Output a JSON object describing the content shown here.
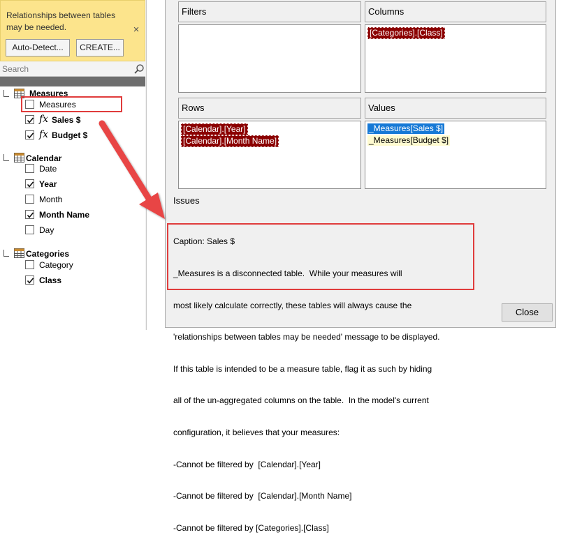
{
  "warning": {
    "message": "Relationships between tables may be needed.",
    "close_glyph": "×",
    "auto_detect_label": "Auto-Detect...",
    "create_label": "CREATE..."
  },
  "search": {
    "placeholder": "Search",
    "icon": "search-icon"
  },
  "tree": {
    "groups": [
      {
        "name": "Measures",
        "icon": "table-icon",
        "fields": [
          {
            "label": "Measures",
            "checked": false,
            "icon": "",
            "bold": false
          },
          {
            "label": "Sales $",
            "checked": true,
            "icon": "fx-icon",
            "bold": true
          },
          {
            "label": "Budget $",
            "checked": true,
            "icon": "fx-icon",
            "bold": true
          }
        ]
      },
      {
        "name": "Calendar",
        "icon": "table-icon",
        "fields": [
          {
            "label": "Date",
            "checked": false,
            "bold": false
          },
          {
            "label": "Year",
            "checked": true,
            "bold": true
          },
          {
            "label": "Month",
            "checked": false,
            "bold": false
          },
          {
            "label": "Month Name",
            "checked": true,
            "bold": true
          },
          {
            "label": "Day",
            "checked": false,
            "bold": false
          }
        ]
      },
      {
        "name": "Categories",
        "icon": "table-icon",
        "fields": [
          {
            "label": "Category",
            "checked": false,
            "bold": false
          },
          {
            "label": "Class",
            "checked": true,
            "bold": true
          }
        ]
      }
    ]
  },
  "areas": {
    "filters": {
      "label": "Filters",
      "items": []
    },
    "columns": {
      "label": "Columns",
      "items": [
        "[Categories].[Class]"
      ]
    },
    "rows": {
      "label": "Rows",
      "items": [
        "[Calendar].[Year]",
        "[Calendar].[Month Name]"
      ]
    },
    "values": {
      "label": "Values",
      "items": [
        "_Measures[Sales $]",
        "_Measures[Budget $]"
      ]
    }
  },
  "issues": {
    "label": "Issues",
    "caption": "Caption: Sales $",
    "lines": [
      "_Measures is a disconnected table.  While your measures will",
      "most likely calculate correctly, these tables will always cause the",
      "'relationships between tables may be needed' message to be displayed.",
      "If this table is intended to be a measure table, flag it as such by hiding",
      "all of the un-aggregated columns on the table.  In the model's current",
      "configuration, it believes that your measures:",
      "-Cannot be filtered by  [Calendar].[Year]",
      "-Cannot be filtered by  [Calendar].[Month Name]",
      "-Cannot be filtered by [Categories].[Class]"
    ]
  },
  "close_label": "Close",
  "colors": {
    "warning_bg": "#fce48c",
    "highlight": "#e03c3c",
    "field_red": "#8b0000",
    "selected_blue": "#1679d6"
  }
}
